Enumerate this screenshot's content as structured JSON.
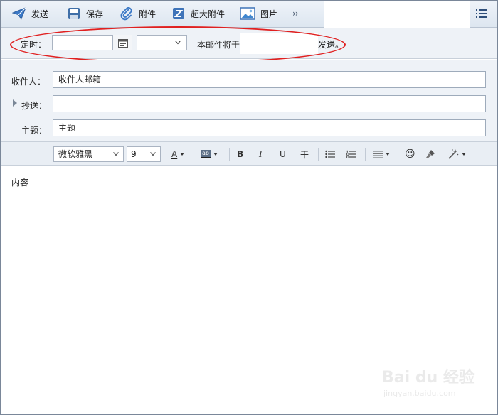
{
  "toolbar": {
    "send": "发送",
    "save": "保存",
    "attach": "附件",
    "large_attach": "超大附件",
    "image": "图片",
    "more": "››"
  },
  "schedule": {
    "label": "定时：",
    "note_before": "本邮件将于",
    "note_after": "发送。"
  },
  "fields": {
    "to_label": "收件人：",
    "to_value": "收件人邮箱",
    "cc_label": "抄送：",
    "cc_value": "",
    "subject_label": "主题：",
    "subject_value": "主题"
  },
  "format": {
    "font": "微软雅黑",
    "size": "9",
    "bold": "B",
    "italic": "I",
    "underline": "U",
    "strike": "干",
    "font_color_glyph": "A",
    "highlight_glyph": "ab",
    "emoji_glyph": "☺"
  },
  "body": {
    "content": "内容"
  },
  "watermark": {
    "main": "Bai du 经验",
    "sub": "jingyan.baidu.com"
  },
  "colors": {
    "accent": "#2f6fb5",
    "annotation": "#e02020"
  }
}
